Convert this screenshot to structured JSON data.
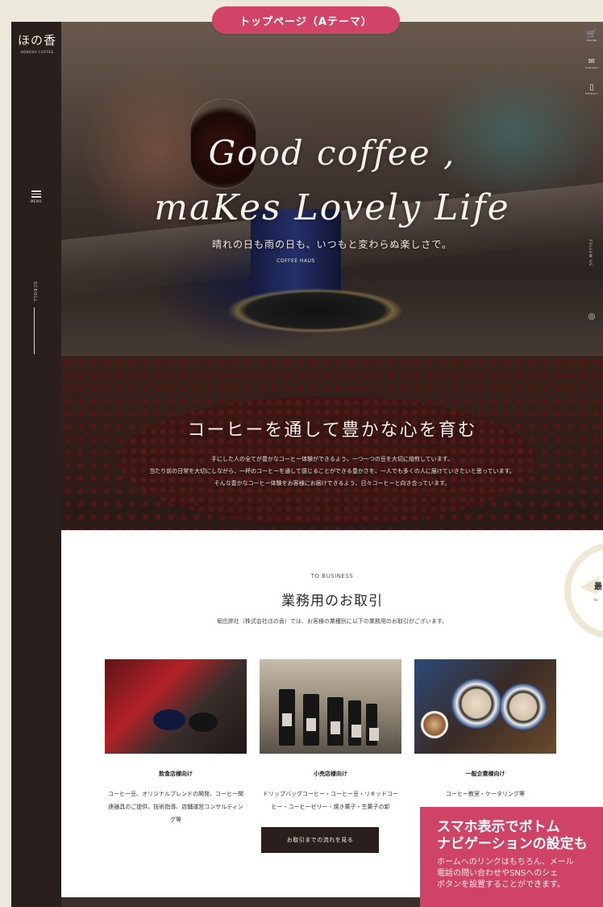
{
  "badge": {
    "label": "トップページ（Aテーマ）"
  },
  "brand": {
    "logo_text": "ほの香",
    "logo_sub": "HONOKA COFFEE"
  },
  "sidebar": {
    "menu_label": "MENU",
    "scroll_label": "SCROLL"
  },
  "hero": {
    "title_line1": "Good coffee ,",
    "title_line2": "maKes Lovely Life",
    "subtitle": "晴れの日も雨の日も、いつもと変わらぬ楽しさで。",
    "mug_text": "COFFEE HAUS"
  },
  "right_nav": {
    "items": [
      {
        "icon": "cart-icon",
        "glyph": "🛒",
        "label": "ONLINE"
      },
      {
        "icon": "mail-icon",
        "glyph": "✉",
        "label": "CONTACT"
      },
      {
        "icon": "document-icon",
        "glyph": "▯",
        "label": "RECRUIT"
      },
      {
        "icon": "instagram-icon",
        "glyph": "◎",
        "label": ""
      }
    ],
    "follow_label": "FOLLOW US"
  },
  "beans": {
    "heading": "コーヒーを通して豊かな心を育む",
    "lines": [
      "手にした人の全てが豊かなコーヒー体験ができるよう、一つ一つの豆を大切に焙煎しています。",
      "当たり前の日常を大切にしながら、一杯のコーヒーを通して感じることができる豊かさを、一人でも多くの人に届けていきたいと思っています。",
      "そんな豊かなコーヒー体験をお客様にお届けできるよう、日々コーヒーと向き合っています。"
    ]
  },
  "business": {
    "eyebrow": "TO BUSINESS",
    "title": "業務用のお取引",
    "lead": "堀庄胖社（株式会社ほの香）では、お客様の業種別に以下の業務用のお取引がございます。",
    "cards": [
      {
        "title": "飲食店様向け",
        "desc": "コーヒー豆、オリジナルブレンドの開発、コーヒー関連器具のご提供、技術指導、店舗運営コンサルティング等"
      },
      {
        "title": "小売店様向け",
        "desc": "ドリップバッグコーヒー・コーヒー豆・リキッドコーヒー・コーヒーゼリー・焼き菓子・生菓子の卸"
      },
      {
        "title": "一般企業様向け",
        "desc": "コーヒー教室・ケータリング等"
      }
    ],
    "button_label": "お取引までの流れを見る"
  },
  "side_widget": {
    "label": "最",
    "sub": "Re"
  },
  "callout": {
    "heading_line1": "スマホ表示でボトム",
    "heading_line2": "ナビゲーションの設定も",
    "body_line1": "ホームへのリンクはもちろん、メール",
    "body_line2": "電話の問い合わせやSNSへのシェ",
    "body_line3": "ボタンを設置することができます。"
  }
}
